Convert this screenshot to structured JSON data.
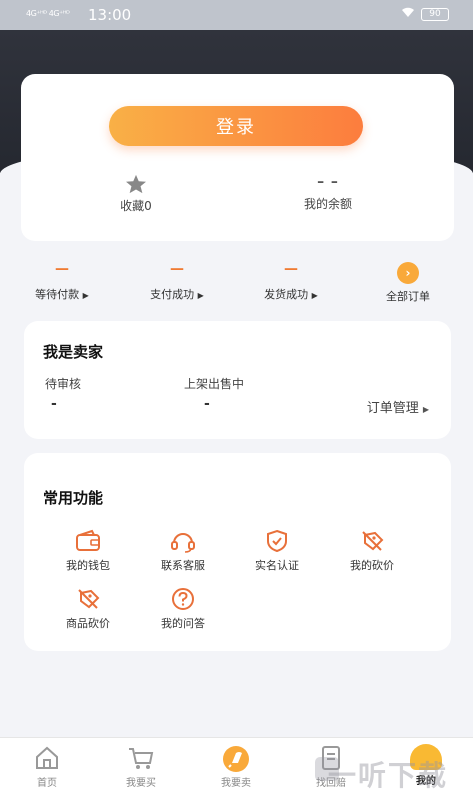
{
  "status_bar": {
    "signal": "4G⁺ᴴᴰ 4G⁺ᴴᴰ",
    "time": "13:00",
    "battery": "90"
  },
  "account": {
    "login_label": "登录",
    "favorites_label": "收藏0",
    "balance_value": "– –",
    "balance_label": "我的余额"
  },
  "orders": {
    "items": [
      {
        "count": "—",
        "label": "等待付款"
      },
      {
        "count": "—",
        "label": "支付成功"
      },
      {
        "count": "—",
        "label": "发货成功"
      }
    ],
    "all_orders_label": "全部订单"
  },
  "seller": {
    "title": "我是卖家",
    "pending_label": "待审核",
    "pending_value": "-",
    "on_sale_label": "上架出售中",
    "on_sale_value": "-",
    "order_manage_label": "订单管理"
  },
  "functions": {
    "title": "常用功能",
    "items": [
      {
        "label": "我的钱包",
        "icon": "wallet-icon"
      },
      {
        "label": "联系客服",
        "icon": "headset-icon"
      },
      {
        "label": "实名认证",
        "icon": "shield-check-icon"
      },
      {
        "label": "我的砍价",
        "icon": "tag-slash-icon"
      },
      {
        "label": "商品砍价",
        "icon": "tag-slash-icon"
      },
      {
        "label": "我的问答",
        "icon": "question-icon"
      }
    ]
  },
  "bottom_nav": {
    "items": [
      {
        "label": "首页",
        "icon": "home-icon"
      },
      {
        "label": "我要买",
        "icon": "cart-icon"
      },
      {
        "label": "我要卖",
        "icon": "rocket-icon"
      },
      {
        "label": "找回赔",
        "icon": "document-icon"
      },
      {
        "label": "我的",
        "icon": "profile-icon"
      }
    ],
    "active": "我的"
  },
  "watermark": "一听下载",
  "colors": {
    "accent_orange": "#fc7d3e",
    "accent_yellow": "#f9b046",
    "header_dark": "#2a2d35"
  }
}
